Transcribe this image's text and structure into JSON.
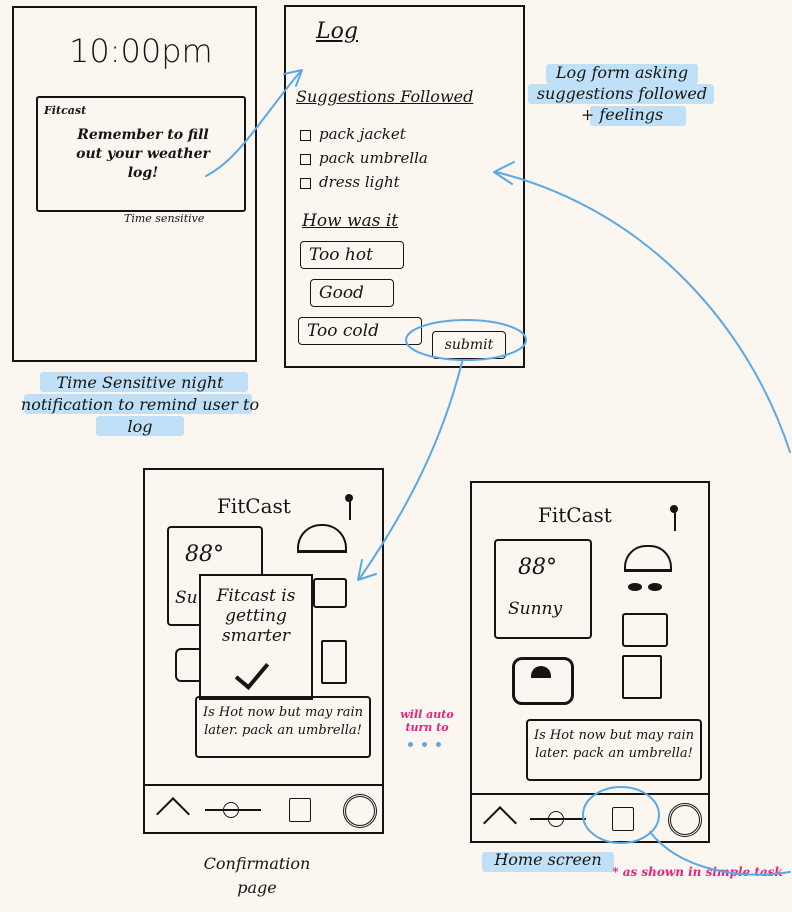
{
  "notif_screen": {
    "time": "10:00pm",
    "app_name": "Fitcast",
    "message": "Remember to fill out your weather log!",
    "label": "Time sensitive",
    "caption": "Time Sensitive night notification to remind user to log"
  },
  "log_screen": {
    "title": "Log",
    "suggestions_heading": "Suggestions Followed",
    "suggestions": [
      "pack jacket",
      "pack umbrella",
      "dress light"
    ],
    "feeling_heading": "How was it",
    "options": [
      "Too hot",
      "Good",
      "Too cold"
    ],
    "submit": "submit",
    "caption": "Log form asking suggestions followed + feelings"
  },
  "confirm_screen": {
    "app_title": "FitCast",
    "temp": "88°",
    "weather_partial": "Su",
    "modal_text": "Fitcast is getting smarter",
    "message": "Is Hot now but may rain later. pack an umbrella!",
    "caption": "Confirmation page",
    "note": "will auto turn to"
  },
  "home_screen": {
    "app_title": "FitCast",
    "temp": "88°",
    "weather": "Sunny",
    "message": "Is Hot now but may rain later. pack an umbrella!",
    "caption": "Home screen",
    "note": "* as shown in simple task"
  },
  "colors": {
    "ink": "#151515",
    "highlight": "#bfe0f6",
    "arrow": "#5aa9e6",
    "pink": "#e8227d",
    "paper": "#fbf6ef"
  }
}
